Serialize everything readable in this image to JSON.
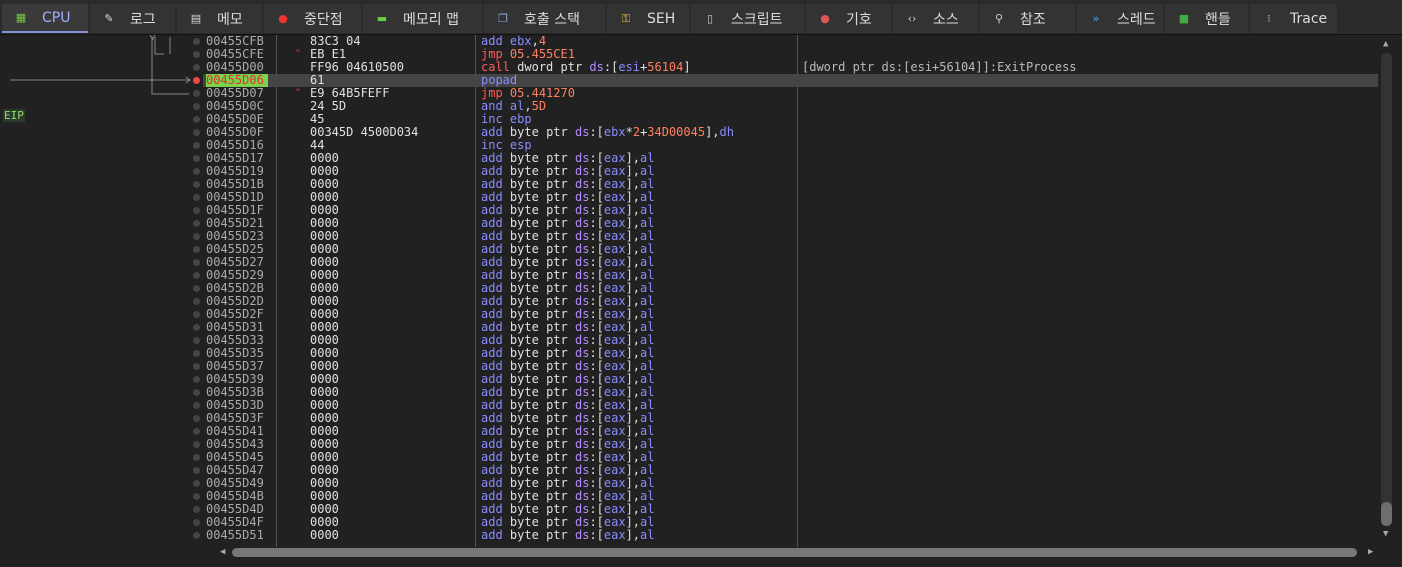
{
  "tabs": [
    {
      "label": "CPU",
      "icon": "cpu-icon"
    },
    {
      "label": "로그",
      "icon": "log-icon"
    },
    {
      "label": "메모",
      "icon": "notes-icon"
    },
    {
      "label": "중단점",
      "icon": "breakpoint-icon"
    },
    {
      "label": "메모리 맵",
      "icon": "memory-map-icon"
    },
    {
      "label": "호출 스택",
      "icon": "call-stack-icon"
    },
    {
      "label": "SEH",
      "icon": "seh-icon"
    },
    {
      "label": "스크립트",
      "icon": "script-icon"
    },
    {
      "label": "기호",
      "icon": "symbols-icon"
    },
    {
      "label": "소스",
      "icon": "source-icon"
    },
    {
      "label": "참조",
      "icon": "references-icon"
    },
    {
      "label": "스레드",
      "icon": "threads-icon"
    },
    {
      "label": "핸들",
      "icon": "handles-icon"
    },
    {
      "label": "Trace",
      "icon": "trace-icon"
    }
  ],
  "eip_label": "EIP",
  "selected_row": 3,
  "rows": [
    {
      "addr": "00455CFB",
      "bytes": "83C3 04",
      "dis": "add ebx,4"
    },
    {
      "addr": "00455CFE",
      "bytes": "EB E1",
      "dis": "jmp 05.455CE1",
      "jump": true
    },
    {
      "addr": "00455D00",
      "bytes": "FF96 04610500",
      "dis": "call dword ptr ds:[esi+56104]",
      "comment": "[dword ptr ds:[esi+56104]]:ExitProcess"
    },
    {
      "addr": "00455D06",
      "bytes": "61",
      "dis": "popad"
    },
    {
      "addr": "00455D07",
      "bytes": "E9 64B5FEFF",
      "dis": "jmp 05.441270",
      "jump": true
    },
    {
      "addr": "00455D0C",
      "bytes": "24 5D",
      "dis": "and al,5D"
    },
    {
      "addr": "00455D0E",
      "bytes": "45",
      "dis": "inc ebp"
    },
    {
      "addr": "00455D0F",
      "bytes": "00345D 4500D034",
      "dis": "add byte ptr ds:[ebx*2+34D00045],dh"
    },
    {
      "addr": "00455D16",
      "bytes": "44",
      "dis": "inc esp"
    },
    {
      "addr": "00455D17",
      "bytes": "0000",
      "dis": "add byte ptr ds:[eax],al"
    },
    {
      "addr": "00455D19",
      "bytes": "0000",
      "dis": "add byte ptr ds:[eax],al"
    },
    {
      "addr": "00455D1B",
      "bytes": "0000",
      "dis": "add byte ptr ds:[eax],al"
    },
    {
      "addr": "00455D1D",
      "bytes": "0000",
      "dis": "add byte ptr ds:[eax],al"
    },
    {
      "addr": "00455D1F",
      "bytes": "0000",
      "dis": "add byte ptr ds:[eax],al"
    },
    {
      "addr": "00455D21",
      "bytes": "0000",
      "dis": "add byte ptr ds:[eax],al"
    },
    {
      "addr": "00455D23",
      "bytes": "0000",
      "dis": "add byte ptr ds:[eax],al"
    },
    {
      "addr": "00455D25",
      "bytes": "0000",
      "dis": "add byte ptr ds:[eax],al"
    },
    {
      "addr": "00455D27",
      "bytes": "0000",
      "dis": "add byte ptr ds:[eax],al"
    },
    {
      "addr": "00455D29",
      "bytes": "0000",
      "dis": "add byte ptr ds:[eax],al"
    },
    {
      "addr": "00455D2B",
      "bytes": "0000",
      "dis": "add byte ptr ds:[eax],al"
    },
    {
      "addr": "00455D2D",
      "bytes": "0000",
      "dis": "add byte ptr ds:[eax],al"
    },
    {
      "addr": "00455D2F",
      "bytes": "0000",
      "dis": "add byte ptr ds:[eax],al"
    },
    {
      "addr": "00455D31",
      "bytes": "0000",
      "dis": "add byte ptr ds:[eax],al"
    },
    {
      "addr": "00455D33",
      "bytes": "0000",
      "dis": "add byte ptr ds:[eax],al"
    },
    {
      "addr": "00455D35",
      "bytes": "0000",
      "dis": "add byte ptr ds:[eax],al"
    },
    {
      "addr": "00455D37",
      "bytes": "0000",
      "dis": "add byte ptr ds:[eax],al"
    },
    {
      "addr": "00455D39",
      "bytes": "0000",
      "dis": "add byte ptr ds:[eax],al"
    },
    {
      "addr": "00455D3B",
      "bytes": "0000",
      "dis": "add byte ptr ds:[eax],al"
    },
    {
      "addr": "00455D3D",
      "bytes": "0000",
      "dis": "add byte ptr ds:[eax],al"
    },
    {
      "addr": "00455D3F",
      "bytes": "0000",
      "dis": "add byte ptr ds:[eax],al"
    },
    {
      "addr": "00455D41",
      "bytes": "0000",
      "dis": "add byte ptr ds:[eax],al"
    },
    {
      "addr": "00455D43",
      "bytes": "0000",
      "dis": "add byte ptr ds:[eax],al"
    },
    {
      "addr": "00455D45",
      "bytes": "0000",
      "dis": "add byte ptr ds:[eax],al"
    },
    {
      "addr": "00455D47",
      "bytes": "0000",
      "dis": "add byte ptr ds:[eax],al"
    },
    {
      "addr": "00455D49",
      "bytes": "0000",
      "dis": "add byte ptr ds:[eax],al"
    },
    {
      "addr": "00455D4B",
      "bytes": "0000",
      "dis": "add byte ptr ds:[eax],al"
    },
    {
      "addr": "00455D4D",
      "bytes": "0000",
      "dis": "add byte ptr ds:[eax],al"
    },
    {
      "addr": "00455D4F",
      "bytes": "0000",
      "dis": "add byte ptr ds:[eax],al"
    },
    {
      "addr": "00455D51",
      "bytes": "0000",
      "dis": "add byte ptr ds:[eax],al"
    }
  ]
}
